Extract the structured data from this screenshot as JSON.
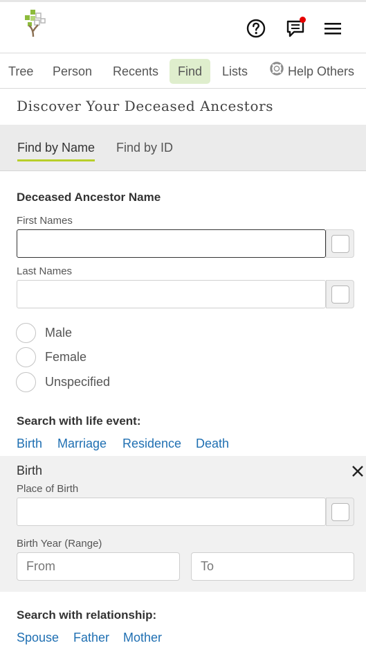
{
  "header": {
    "logo_icon": "family-tree-logo",
    "help_icon": "question-circle-icon",
    "messages_icon": "chat-bubble-icon",
    "menu_icon": "hamburger-menu-icon",
    "notification_color": "#e60000"
  },
  "nav": {
    "items": [
      {
        "label": "Tree"
      },
      {
        "label": "Person"
      },
      {
        "label": "Recents"
      },
      {
        "label": "Find"
      },
      {
        "label": "Lists"
      },
      {
        "label": "Help Others",
        "icon": "lifebuoy-icon"
      }
    ],
    "active": "Find",
    "active_color": "#dfeecd"
  },
  "page": {
    "title": "Discover Your Deceased Ancestors"
  },
  "tabs": {
    "items": [
      {
        "label": "Find by Name"
      },
      {
        "label": "Find by ID"
      }
    ],
    "active": "Find by Name",
    "underline_color": "#b8cf2a"
  },
  "form": {
    "name_heading": "Deceased Ancestor Name",
    "first_names": {
      "label": "First Names",
      "value": ""
    },
    "last_names": {
      "label": "Last Names",
      "value": ""
    },
    "gender_options": [
      "Male",
      "Female",
      "Unspecified"
    ],
    "life_event_heading": "Search with life event:",
    "life_events": [
      "Birth",
      "Marriage",
      "Residence",
      "Death"
    ],
    "birth": {
      "title": "Birth",
      "place_label": "Place of Birth",
      "place_value": "",
      "year_label": "Birth Year (Range)",
      "from_placeholder": "From",
      "to_placeholder": "To"
    },
    "relationship_heading": "Search with relationship:",
    "relationships": [
      "Spouse",
      "Father",
      "Mother"
    ],
    "link_color": "#1f6fb2"
  }
}
